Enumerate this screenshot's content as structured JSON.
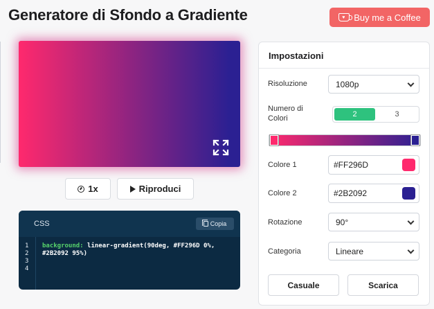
{
  "header": {
    "title": "Generatore di Sfondo a Gradiente",
    "coffee_label": "Buy me a Coffee"
  },
  "preview": {
    "colors": [
      "#FF296D",
      "#2B2092"
    ]
  },
  "controls": {
    "speed_label": "1x",
    "play_label": "Riproduci"
  },
  "code": {
    "tab_label": "CSS",
    "copy_label": "Copia",
    "line_numbers": [
      "1",
      "2",
      "3",
      "4"
    ],
    "property": "background:",
    "value_line1": " linear-gradient(90deg, #FF296D 0%,",
    "value_line2": "#2B2092 95%)"
  },
  "settings": {
    "title": "Impostazioni",
    "resolution_label": "Risoluzione",
    "resolution_value": "1080p",
    "num_colors_label_1": "Numero di",
    "num_colors_label_2": "Colori",
    "num_colors_options": [
      "2",
      "3"
    ],
    "num_colors_selected": "2",
    "color1_label": "Colore 1",
    "color1_value": "#FF296D",
    "color2_label": "Colore 2",
    "color2_value": "#2B2092",
    "rotation_label": "Rotazione",
    "rotation_value": "90°",
    "category_label": "Categoria",
    "category_value": "Lineare",
    "random_label": "Casuale",
    "download_label": "Scarica"
  }
}
